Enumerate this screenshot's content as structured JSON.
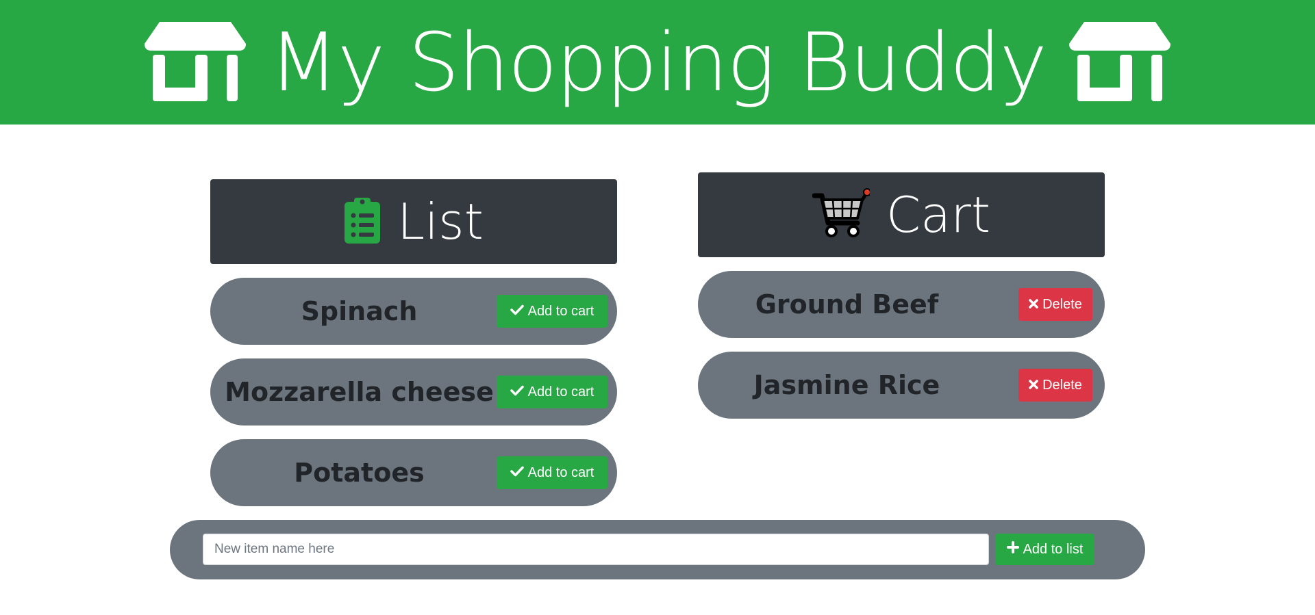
{
  "header": {
    "title": "My Shopping Buddy",
    "left_icon": "store-icon",
    "right_icon": "store-icon",
    "background": "#28a745"
  },
  "list_panel": {
    "title": "List",
    "icon": "clipboard-list-icon",
    "items": [
      {
        "name": "Spinach",
        "button_label": "Add to cart"
      },
      {
        "name": "Mozzarella cheese",
        "button_label": "Add to cart"
      },
      {
        "name": "Potatoes",
        "button_label": "Add to cart"
      }
    ]
  },
  "cart_panel": {
    "title": "Cart",
    "icon": "shopping-cart-icon",
    "items": [
      {
        "name": "Ground Beef",
        "button_label": "Delete"
      },
      {
        "name": "Jasmine Rice",
        "button_label": "Delete"
      }
    ]
  },
  "add_bar": {
    "placeholder": "New item name here",
    "value": "",
    "button_label": "Add to list"
  },
  "colors": {
    "accent": "#28a745",
    "danger": "#dc3545",
    "panel_head": "#343a40",
    "row_bg": "#6c757d"
  }
}
